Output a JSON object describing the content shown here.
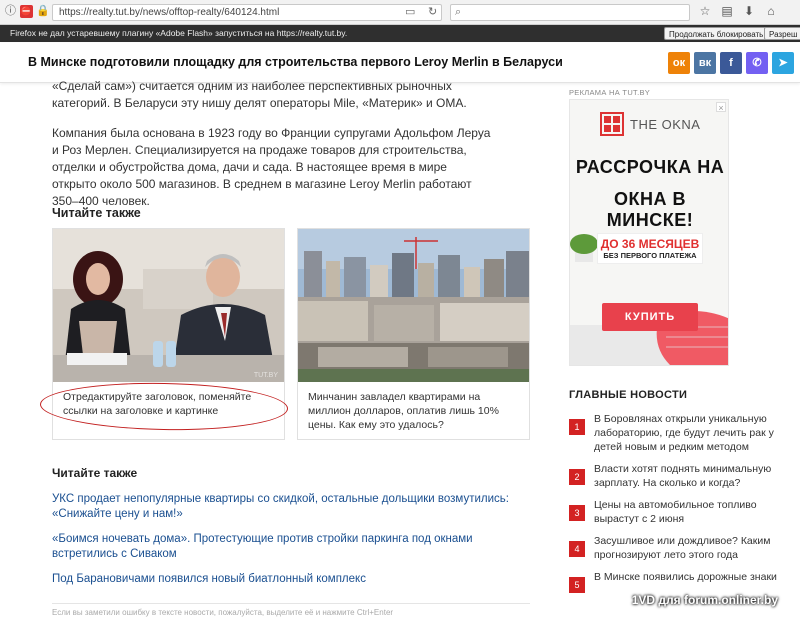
{
  "browser": {
    "url": "https://realty.tut.by/news/offtop-realty/640124.html",
    "notification": "Firefox не дал устаревшему плагину «Adobe Flash» запуститься на https://realty.tut.by.",
    "allow_block_btn": "Продолжать блокировать",
    "allow_btn": "Разреш"
  },
  "article": {
    "title": "В Минске подготовили площадку для строительства первого Leroy Merlin в Беларуси",
    "para1": "«Сделай сам») считается одним из наиболее перспективных рыночных категорий. В Беларуси эту нишу делят операторы Mile, «Материк» и ОМА.",
    "para2": "Компания была основана в 1923 году во Франции супругами Адольфом Леруа и Роз Мерлен. Специализируется на продаже товаров для строительства, отделки и обустройства дома, дачи и сада. В настоящее время в мире открыто около 500 магазинов. В среднем в магазине Leroy Merlin работают 350–400 человек.",
    "read_also": "Читайте также",
    "cards": [
      {
        "text": "Отредактируйте заголовок, поменяйте ссылки на заголовке и картинке",
        "watermark": "TUT.BY"
      },
      {
        "text": "Минчанин завладел квартирами на миллион долларов, оплатив лишь 10% цены. Как ему это удалось?"
      }
    ],
    "read_also_2": "Читайте также",
    "links": [
      "УКС продает непопулярные квартиры со скидкой, остальные дольщики возмутились: «Снижайте цену и нам!»",
      "«Боимся ночевать дома». Протестующие против стройки паркинга под окнами встретились с Сиваком",
      "Под Барановичами появился новый биатлонный комплекс"
    ],
    "footer_note": "Если вы заметили ошибку в тексте новости, пожалуйста, выделите её и нажмите Ctrl+Enter"
  },
  "share": [
    {
      "icon": "odnoklassniki-icon",
      "glyph": "ок",
      "color": "#ee8208"
    },
    {
      "icon": "vk-icon",
      "glyph": "вк",
      "color": "#4c75a3"
    },
    {
      "icon": "facebook-icon",
      "glyph": "f",
      "color": "#3b5998"
    },
    {
      "icon": "viber-icon",
      "glyph": "✆",
      "color": "#7360f2"
    },
    {
      "icon": "telegram-icon",
      "glyph": "➤",
      "color": "#2ca5e0"
    }
  ],
  "ad": {
    "label": "РЕКЛАМА НА TUT.BY",
    "brand": "THE OKNA",
    "line1": "РАССРОЧКА НА",
    "line2": "ОКНА В МИНСКЕ!",
    "badge1": "ДО 36 МЕСЯЦЕВ",
    "badge2": "БЕЗ ПЕРВОГО ПЛАТЕЖА",
    "button": "КУПИТЬ"
  },
  "news": {
    "title": "ГЛАВНЫЕ НОВОСТИ",
    "items": [
      {
        "num": "1",
        "text": "В Боровлянах открыли уникальную лабораторию, где будут лечить рак у детей новым и редким методом"
      },
      {
        "num": "2",
        "text": "Власти хотят поднять минимальную зарплату. На сколько и когда?"
      },
      {
        "num": "3",
        "text": "Цены на автомобильное топливо вырастут с 2 июня"
      },
      {
        "num": "4",
        "text": "Засушливое или дождливое? Каким прогнозируют лето этого года"
      },
      {
        "num": "5",
        "text": "В Минске появились дорожные знаки"
      }
    ]
  },
  "credit": "1VD для forum.onliner.by"
}
